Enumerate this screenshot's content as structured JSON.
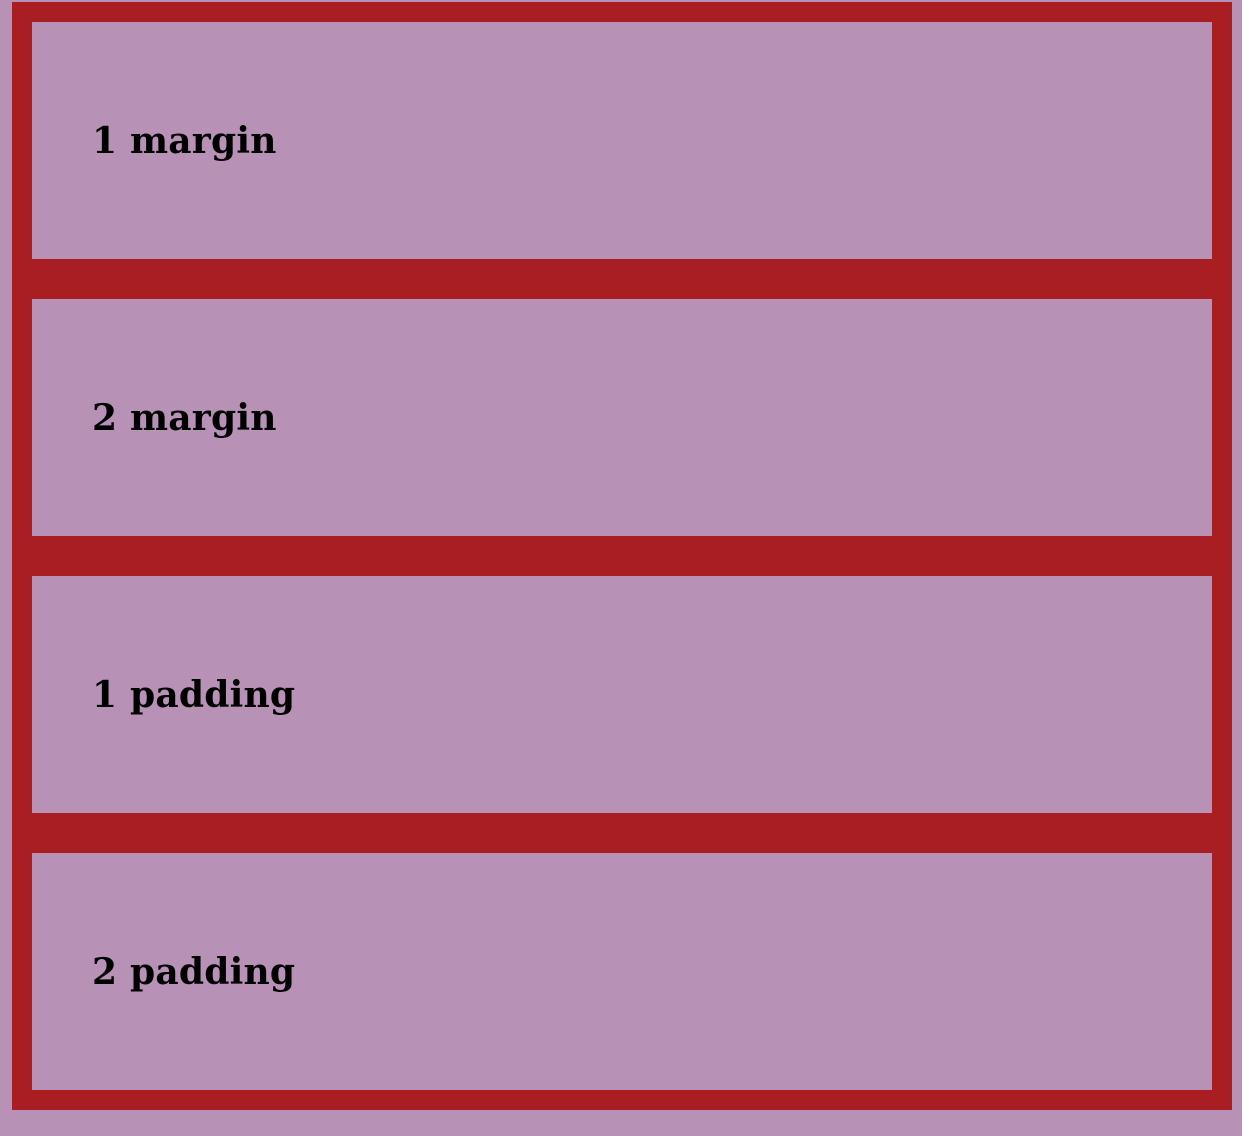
{
  "colors": {
    "background": "#b792b6",
    "frame": "#a91e22",
    "text": "#000000"
  },
  "boxes": [
    {
      "label": "1 margin"
    },
    {
      "label": "2 margin"
    },
    {
      "label": "1 padding"
    },
    {
      "label": "2 padding"
    }
  ]
}
